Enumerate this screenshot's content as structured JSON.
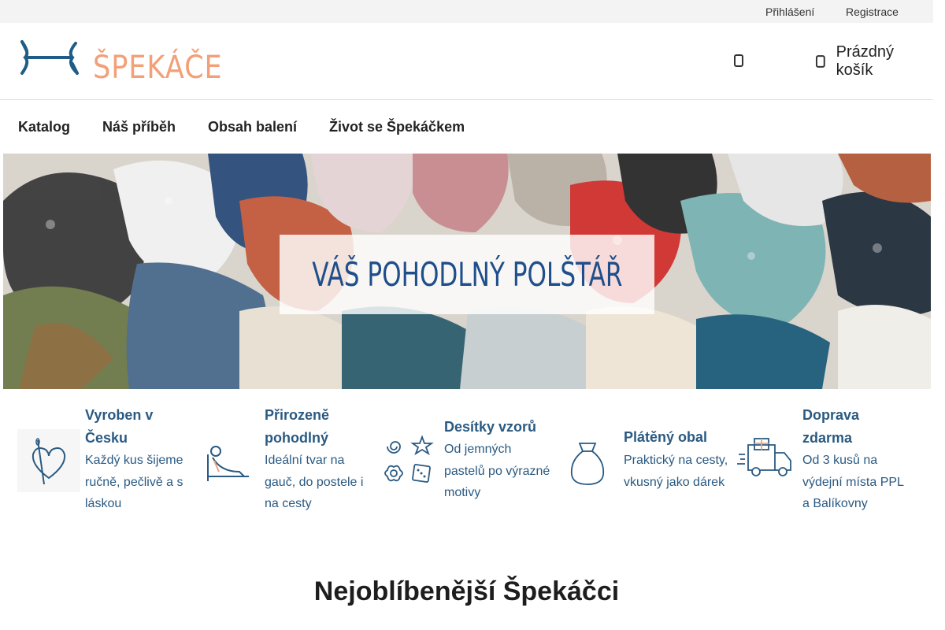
{
  "topbar": {
    "login": "Přihlášení",
    "register": "Registrace"
  },
  "header": {
    "logo_alt": "ŠPEKÁČEK.CZ",
    "search_icon": "search-icon",
    "cart_icon": "cart-icon",
    "cart_label": "Prázdný košík"
  },
  "nav": {
    "items": [
      {
        "label": "Katalog"
      },
      {
        "label": "Náš příběh"
      },
      {
        "label": "Obsah balení"
      },
      {
        "label": "Život se Špekáčkem"
      }
    ]
  },
  "hero": {
    "caption": "VÁŠ POHODLNÝ POLŠTÁŘ"
  },
  "benefits": [
    {
      "icon": "needle-heart-icon",
      "title": "Vyroben v Česku",
      "text": "Každý kus šijeme ručně, pečlivě a s láskou"
    },
    {
      "icon": "person-resting-icon",
      "title": "Přirozeně pohodlný",
      "text": "Ideální tvar na gauč, do postele i na cesty"
    },
    {
      "icon": "patterns-icon",
      "title": "Desítky vzorů",
      "text": "Od jemných pastelů po výrazné motivy"
    },
    {
      "icon": "cloth-bag-icon",
      "title": "Plátěný obal",
      "text": "Praktický na cesty, vkusný jako dárek"
    },
    {
      "icon": "delivery-truck-icon",
      "title": "Doprava zdarma",
      "text": "Od 3 kusů na výdejní místa PPL a Balíkovny"
    }
  ],
  "section": {
    "heading": "Nejoblíbenější Špekáčci"
  },
  "colors": {
    "brand_blue": "#2a5a82",
    "logo_orange": "#f2a07a",
    "logo_blue": "#1f5d86"
  }
}
